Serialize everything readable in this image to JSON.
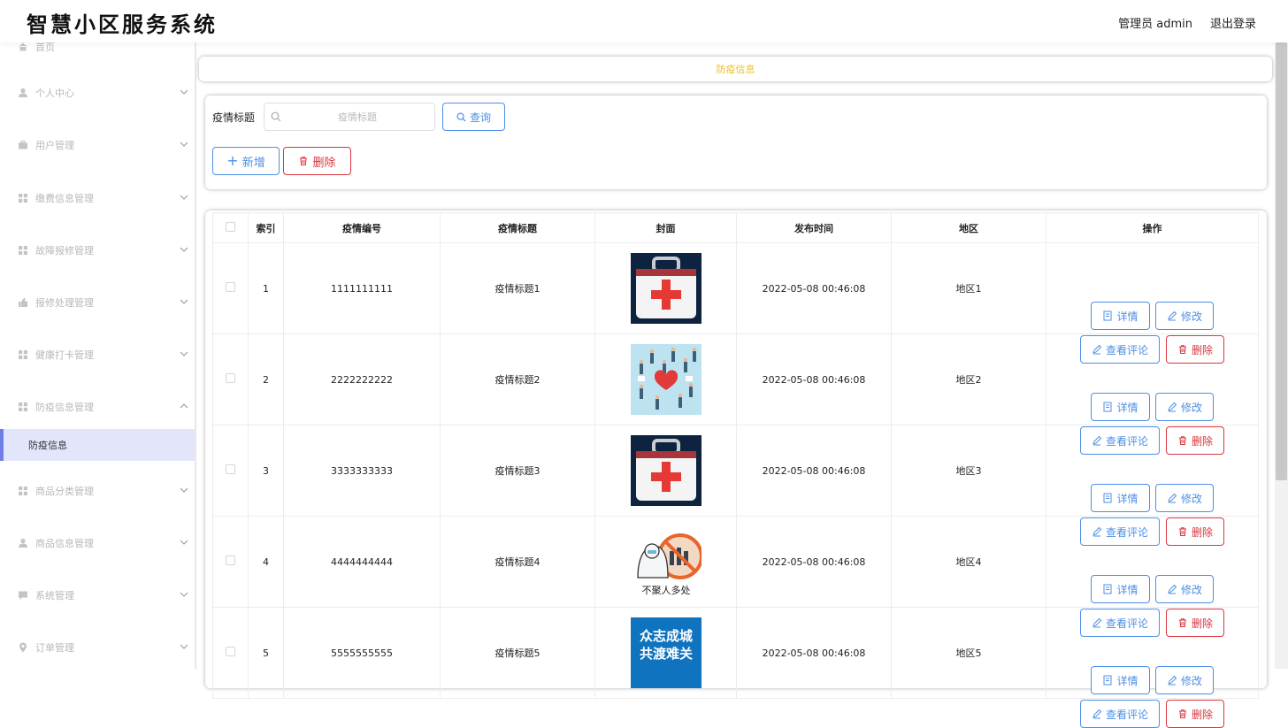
{
  "header": {
    "title": "智慧小区服务系统",
    "user": "管理员 admin",
    "logout": "退出登录"
  },
  "sidebar": {
    "items": [
      {
        "label": "首页",
        "icon": "home-icon",
        "chevron": false
      },
      {
        "label": "个人中心",
        "icon": "user-icon",
        "chevron": true
      },
      {
        "label": "用户管理",
        "icon": "briefcase-icon",
        "chevron": true
      },
      {
        "label": "缴费信息管理",
        "icon": "grid-icon",
        "chevron": true
      },
      {
        "label": "故障报修管理",
        "icon": "grid-icon",
        "chevron": true
      },
      {
        "label": "报修处理管理",
        "icon": "thumb-icon",
        "chevron": true
      },
      {
        "label": "健康打卡管理",
        "icon": "grid-icon",
        "chevron": true
      },
      {
        "label": "防疫信息管理",
        "icon": "grid-icon",
        "chevron": true,
        "expanded": true
      },
      {
        "label": "商品分类管理",
        "icon": "grid-icon",
        "chevron": true
      },
      {
        "label": "商品信息管理",
        "icon": "user-icon",
        "chevron": true
      },
      {
        "label": "系统管理",
        "icon": "chat-icon",
        "chevron": true
      },
      {
        "label": "订单管理",
        "icon": "pin-icon",
        "chevron": true
      }
    ],
    "active_sub": "防疫信息"
  },
  "breadcrumb": "防疫信息",
  "search": {
    "label": "疫情标题",
    "placeholder": "疫情标题",
    "query_button": "查询"
  },
  "actions": {
    "add": "新增",
    "delete": "删除"
  },
  "table": {
    "columns": [
      "索引",
      "疫情编号",
      "疫情标题",
      "封面",
      "发布时间",
      "地区",
      "操作"
    ],
    "rows": [
      {
        "index": "1",
        "code": "1111111111",
        "title": "疫情标题1",
        "cover": "first-aid-kit",
        "time": "2022-05-08 00:46:08",
        "region": "地区1"
      },
      {
        "index": "2",
        "code": "2222222222",
        "title": "疫情标题2",
        "cover": "heart-people",
        "time": "2022-05-08 00:46:08",
        "region": "地区2"
      },
      {
        "index": "3",
        "code": "3333333333",
        "title": "疫情标题3",
        "cover": "first-aid-kit",
        "time": "2022-05-08 00:46:08",
        "region": "地区3"
      },
      {
        "index": "4",
        "code": "4444444444",
        "title": "疫情标题4",
        "cover": "no-gathering",
        "time": "2022-05-08 00:46:08",
        "region": "地区4"
      },
      {
        "index": "5",
        "code": "5555555555",
        "title": "疫情标题5",
        "cover": "slogan-poster",
        "time": "2022-05-08 00:46:08",
        "region": "地区5"
      }
    ],
    "row_buttons": {
      "detail": "详情",
      "edit": "修改",
      "comments": "查看评论",
      "delete": "删除"
    },
    "cover_texts": {
      "no_gathering": "不聚人多处",
      "slogan_line1": "众志成城",
      "slogan_line2": "共渡难关"
    }
  },
  "colors": {
    "primary": "#4d8fe6",
    "danger": "#d9363e",
    "breadcrumb": "#e9c02e",
    "active_menu_bg": "#e3e6fb",
    "active_menu_bar": "#6f7ee6"
  }
}
